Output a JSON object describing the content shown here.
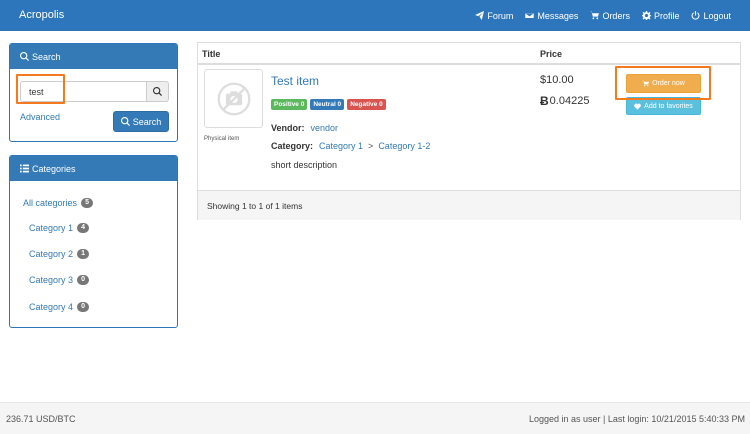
{
  "navbar": {
    "brand": "Acropolis",
    "links": [
      {
        "label": "Forum",
        "icon": "send-icon"
      },
      {
        "label": "Messages",
        "icon": "envelope-icon"
      },
      {
        "label": "Orders",
        "icon": "cart-icon"
      },
      {
        "label": "Profile",
        "icon": "gear-icon"
      },
      {
        "label": "Logout",
        "icon": "power-icon"
      }
    ]
  },
  "search_panel": {
    "heading": "Search",
    "query": "test",
    "advanced_label": "Advanced",
    "button_label": "Search"
  },
  "categories_panel": {
    "heading": "Categories",
    "items": [
      {
        "label": "All categories",
        "count": "5"
      },
      {
        "label": "Category 1",
        "count": "4"
      },
      {
        "label": "Category 2",
        "count": "1"
      },
      {
        "label": "Category 3",
        "count": "0"
      },
      {
        "label": "Category 4",
        "count": "0"
      }
    ]
  },
  "results": {
    "columns": {
      "title": "Title",
      "price": "Price"
    },
    "item": {
      "thumb_caption": "Physical item",
      "title": "Test item",
      "labels": {
        "positive": "Positive 0",
        "neutral": "Neutral 0",
        "negative": "Negative 0"
      },
      "vendor_label": "Vendor:",
      "vendor": "vendor",
      "category_label": "Category:",
      "category": "Category 1",
      "category_sep": ">",
      "subcategory": "Category 1-2",
      "description": "short description",
      "price_usd": "$10.00",
      "price_btc_symbol": "Ƀ",
      "price_btc": "0.04225",
      "order_label": "Order now",
      "favorite_label": "Add to favorites"
    },
    "footer_text": "Showing 1 to 1 of 1 items"
  },
  "footer": {
    "rate": "236.71 USD/BTC",
    "login_info": "Logged in as user | Last login: 10/21/2015 5:40:33 PM"
  },
  "colors": {
    "navbar": "#2e76bb",
    "highlight": "#f47920",
    "order_button": "#f0ad4e",
    "favorite_button": "#5bc0de"
  }
}
